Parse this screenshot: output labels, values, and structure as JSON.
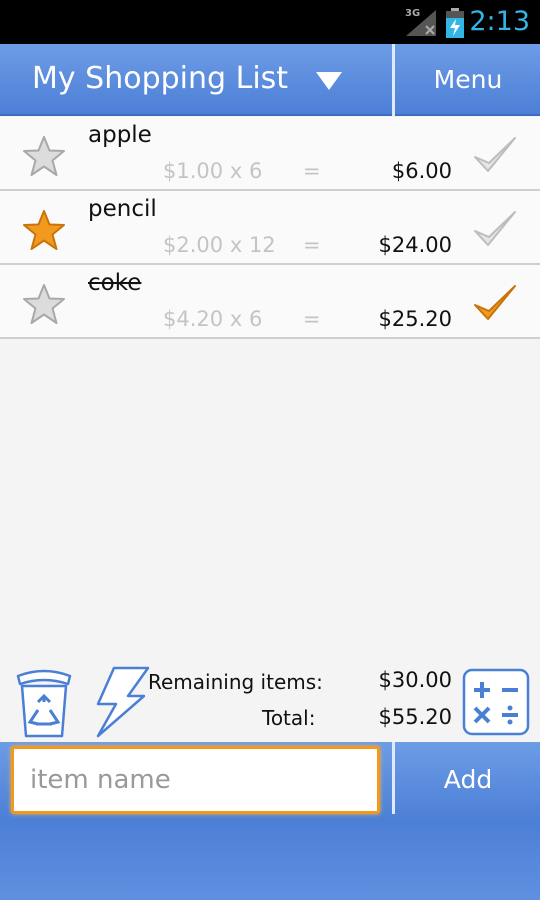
{
  "status_bar": {
    "network": "3G",
    "time": "2:13"
  },
  "header": {
    "title": "My Shopping List",
    "menu_label": "Menu"
  },
  "items": [
    {
      "name": "apple",
      "price": "$1.00",
      "qty": "6",
      "equals": "=",
      "amount": "$6.00",
      "starred": false,
      "checked": false
    },
    {
      "name": "pencil",
      "price": "$2.00",
      "qty": "12",
      "equals": "=",
      "amount": "$24.00",
      "starred": true,
      "checked": false
    },
    {
      "name": "coke",
      "price": "$4.20",
      "qty": "6",
      "equals": "=",
      "amount": "$25.20",
      "starred": false,
      "checked": true
    }
  ],
  "summary": {
    "remaining_label": "Remaining items:",
    "remaining_value": "$30.00",
    "total_label": "Total:",
    "total_value": "$55.20"
  },
  "input_bar": {
    "placeholder": "item name",
    "add_label": "Add"
  },
  "colors": {
    "accent_blue": "#4c7fd6",
    "star_active": "#f29a1d",
    "check_active": "#f29a1d",
    "focus_border": "#f29a1d"
  }
}
